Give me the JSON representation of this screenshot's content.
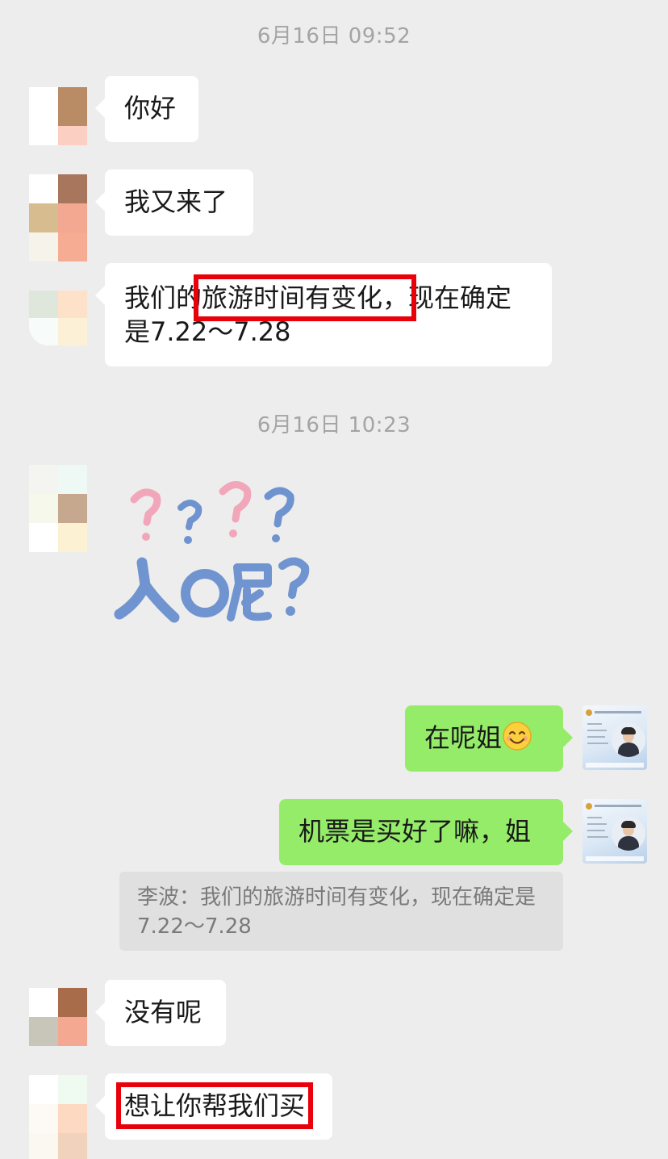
{
  "chat": {
    "timestamps": [
      "6月16日 09:52",
      "6月16日 10:23"
    ],
    "messages": {
      "m1": "你好",
      "m2": "我又来了",
      "m3_before": "我们的",
      "m3_highlight": "旅游时间有变化，",
      "m3_after": "现在确定是7.22～7.28",
      "m4_sticker_text": "人呢?",
      "m5": "在呢姐",
      "m5_emoji": "smiling-face-emoji",
      "m6": "机票是买好了嘛，姐",
      "quote": "李波：我们的旅游时间有变化，现在确定是7.22～7.28",
      "m7": "没有呢",
      "m8": "想让你帮我们买"
    }
  },
  "colors": {
    "background": "#ededed",
    "incoming_bubble": "#ffffff",
    "outgoing_bubble": "#95ec69",
    "highlight_box": "#e8000b",
    "sticker_pink": "#f2a6b9",
    "sticker_blue": "#6f93cf"
  }
}
